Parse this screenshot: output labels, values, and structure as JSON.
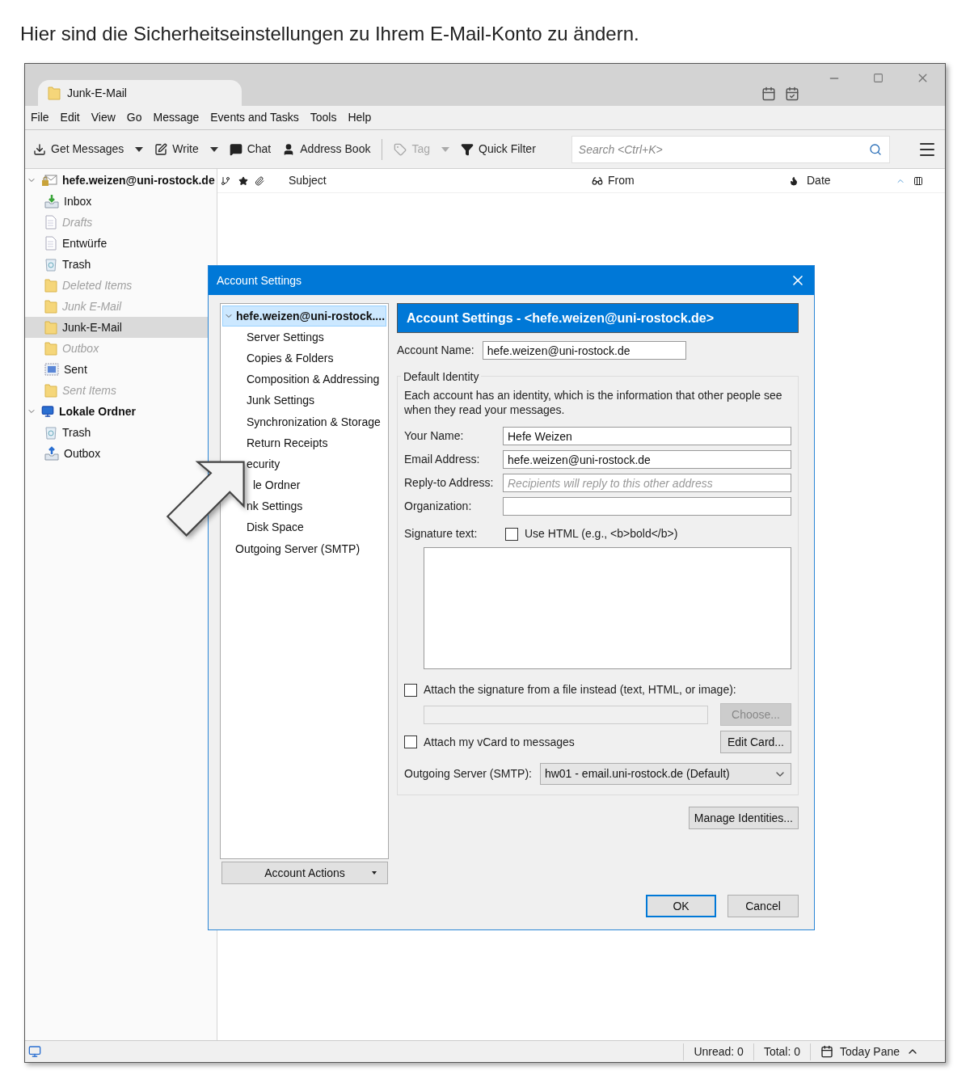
{
  "caption": "Hier sind die Sicherheitseinstellungen zu Ihrem E-Mail-Konto zu ändern.",
  "window": {
    "tab_title": "Junk-E-Mail",
    "menu": [
      "File",
      "Edit",
      "View",
      "Go",
      "Message",
      "Events and Tasks",
      "Tools",
      "Help"
    ],
    "toolbar": [
      {
        "label": "Get Messages",
        "kind": "download",
        "dropdown": true,
        "disabled": false
      },
      {
        "label": "Write",
        "kind": "write",
        "dropdown": true,
        "disabled": false
      },
      {
        "label": "Chat",
        "kind": "chat",
        "dropdown": false,
        "disabled": false
      },
      {
        "label": "Address Book",
        "kind": "contact",
        "dropdown": false,
        "disabled": false
      },
      {
        "label": "Tag",
        "kind": "tag",
        "dropdown": true,
        "disabled": true
      },
      {
        "label": "Quick Filter",
        "kind": "filter",
        "dropdown": false,
        "disabled": false
      }
    ],
    "search": {
      "placeholder": "Search <Ctrl+K>"
    },
    "folders": [
      {
        "name": "hefe.weizen@uni-rostock.de",
        "kind": "account",
        "selected": false,
        "dimmed": false,
        "children": [
          {
            "name": "Inbox",
            "kind": "inbox",
            "selected": false,
            "dimmed": false
          },
          {
            "name": "Drafts",
            "kind": "draft",
            "selected": false,
            "dimmed": true
          },
          {
            "name": "Entwürfe",
            "kind": "draft",
            "selected": false,
            "dimmed": false
          },
          {
            "name": "Trash",
            "kind": "trash",
            "selected": false,
            "dimmed": false
          },
          {
            "name": "Deleted Items",
            "kind": "folder",
            "selected": false,
            "dimmed": true
          },
          {
            "name": "Junk E-Mail",
            "kind": "folder",
            "selected": false,
            "dimmed": true
          },
          {
            "name": "Junk-E-Mail",
            "kind": "folder",
            "selected": true,
            "dimmed": false
          },
          {
            "name": "Outbox",
            "kind": "folder",
            "selected": false,
            "dimmed": true
          },
          {
            "name": "Sent",
            "kind": "sent",
            "selected": false,
            "dimmed": false
          },
          {
            "name": "Sent Items",
            "kind": "folder",
            "selected": false,
            "dimmed": true
          }
        ]
      },
      {
        "name": "Lokale Ordner",
        "kind": "local",
        "selected": false,
        "dimmed": false,
        "children": [
          {
            "name": "Trash",
            "kind": "trash",
            "selected": false,
            "dimmed": false
          },
          {
            "name": "Outbox",
            "kind": "outbox",
            "selected": false,
            "dimmed": false
          }
        ]
      }
    ],
    "columns": [
      "Subject",
      "From",
      "Date"
    ],
    "status": {
      "unread": "Unread: 0",
      "total": "Total: 0",
      "today_pane": "Today Pane"
    }
  },
  "dialog": {
    "title": "Account Settings",
    "tree": [
      {
        "label": "hefe.weizen@uni-rostock....",
        "selected": true,
        "children": [
          {
            "label": "Server Settings",
            "selected": false
          },
          {
            "label": "Copies & Folders",
            "selected": false
          },
          {
            "label": "Composition & Addressing",
            "selected": false
          },
          {
            "label": "Junk Settings",
            "selected": false
          },
          {
            "label": "Synchronization & Storage",
            "selected": false
          },
          {
            "label": "Return Receipts",
            "selected": false
          },
          {
            "label": "ecurity",
            "selected": false
          }
        ]
      },
      {
        "label": "le Ordner",
        "selected": false,
        "children": [
          {
            "label": "nk Settings",
            "selected": false
          },
          {
            "label": "Disk Space",
            "selected": false
          }
        ]
      },
      {
        "label": "Outgoing Server (SMTP)",
        "selected": false
      }
    ],
    "account_actions": "Account Actions",
    "heading": "Account Settings - <hefe.weizen@uni-rostock.de>",
    "account_name": {
      "label": "Account Name:",
      "value": "hefe.weizen@uni-rostock.de"
    },
    "identity": {
      "legend": "Default Identity",
      "description": "Each account has an identity, which is the information that other people see when they read your messages.",
      "fields": [
        {
          "label": "Your Name:",
          "value": "Hefe Weizen"
        },
        {
          "label": "Email Address:",
          "value": "hefe.weizen@uni-rostock.de"
        },
        {
          "label": "Reply-to Address:",
          "placeholder": "Recipients will reply to this other address"
        },
        {
          "label": "Organization:"
        }
      ],
      "signature_label": "Signature text:",
      "use_html": {
        "label": "Use HTML (e.g., <b>bold</b>)",
        "checked": false
      },
      "attach_file": {
        "label": "Attach the signature from a file instead (text, HTML, or image):",
        "checked": false
      },
      "choose": {
        "label": "Choose...",
        "disabled": true
      },
      "vcard": {
        "label": "Attach my vCard to messages",
        "checked": false
      },
      "edit_card": "Edit Card...",
      "smtp_label": "Outgoing Server (SMTP):",
      "smtp_value": "hw01 - email.uni-rostock.de (Default)"
    },
    "manage": "Manage Identities...",
    "ok": "OK",
    "cancel": "Cancel"
  }
}
